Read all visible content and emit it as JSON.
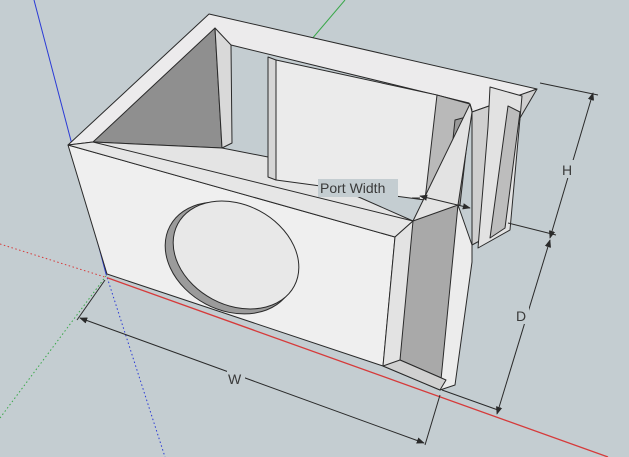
{
  "viewport": {
    "background": "#c4cdd1",
    "axes": {
      "red_axis_color": "#d63a3a",
      "green_axis_color": "#3aa84a",
      "blue_axis_color": "#2a3ad6"
    }
  },
  "model": {
    "face_color": "#ecebec",
    "shadow_face_color": "#b4b4b4",
    "edge_color": "#2a2a2a",
    "woofer_cutout_shape": "ellipse"
  },
  "dimensions": {
    "port_width": "Port Width",
    "height": "H",
    "depth": "D",
    "width": "W"
  }
}
